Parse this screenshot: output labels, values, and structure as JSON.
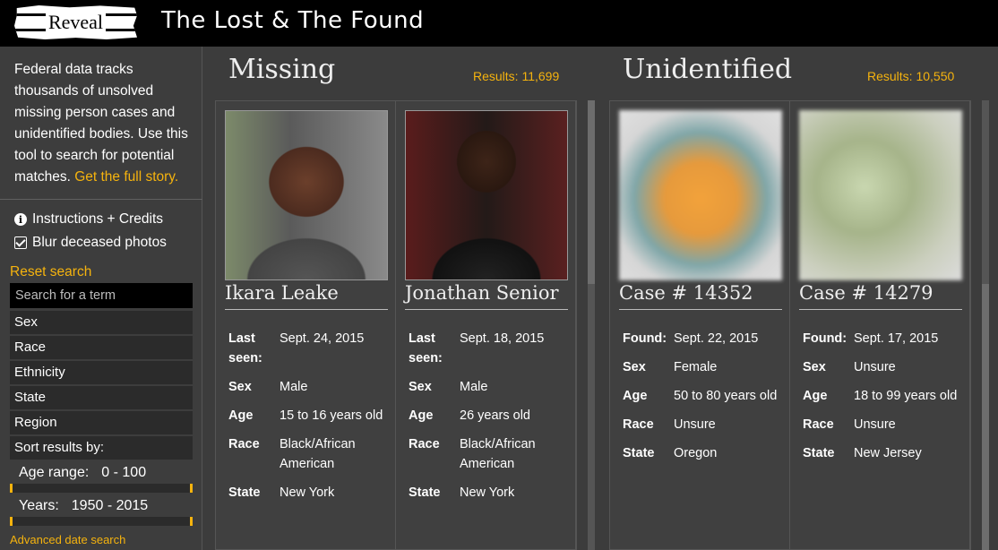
{
  "header": {
    "logo": "Reveal",
    "title": "The Lost & The Found"
  },
  "sidebar": {
    "intro": "Federal data tracks thousands of unsolved missing person cases and unidentified bodies. Use this tool to search for potential matches.",
    "intro_link": "Get the full story.",
    "instructions_label": "Instructions + Credits",
    "blur_label": "Blur deceased photos",
    "reset_label": "Reset search",
    "search_placeholder": "Search for a term",
    "filters": [
      "Sex",
      "Race",
      "Ethnicity",
      "State",
      "Region",
      "Sort results by:"
    ],
    "age_label": "Age range:",
    "age_value": "0 - 100",
    "years_label": "Years:",
    "years_value": "1950 - 2015",
    "advanced_label": "Advanced date search"
  },
  "missing": {
    "title": "Missing",
    "results": "Results: 11,699",
    "cards": [
      {
        "name": "Ikara Leake",
        "rows": [
          {
            "k": "Last seen:",
            "v": "Sept. 24, 2015"
          },
          {
            "k": "Sex",
            "v": "Male"
          },
          {
            "k": "Age",
            "v": "15 to 16 years old"
          },
          {
            "k": "Race",
            "v": "Black/African American"
          },
          {
            "k": "State",
            "v": "New York"
          }
        ]
      },
      {
        "name": "Jonathan Senior",
        "rows": [
          {
            "k": "Last seen:",
            "v": "Sept. 18, 2015"
          },
          {
            "k": "Sex",
            "v": "Male"
          },
          {
            "k": "Age",
            "v": "26 years old"
          },
          {
            "k": "Race",
            "v": "Black/African American"
          },
          {
            "k": "State",
            "v": "New York"
          }
        ]
      }
    ]
  },
  "unidentified": {
    "title": "Unidentified",
    "results": "Results: 10,550",
    "cards": [
      {
        "name": "Case # 14352",
        "rows": [
          {
            "k": "Found:",
            "v": "Sept. 22, 2015"
          },
          {
            "k": "Sex",
            "v": "Female"
          },
          {
            "k": "Age",
            "v": "50 to 80 years old"
          },
          {
            "k": "Race",
            "v": "Unsure"
          },
          {
            "k": "State",
            "v": "Oregon"
          }
        ]
      },
      {
        "name": "Case # 14279",
        "rows": [
          {
            "k": "Found:",
            "v": "Sept. 17, 2015"
          },
          {
            "k": "Sex",
            "v": "Unsure"
          },
          {
            "k": "Age",
            "v": "18 to 99 years old"
          },
          {
            "k": "Race",
            "v": "Unsure"
          },
          {
            "k": "State",
            "v": "New Jersey"
          }
        ]
      }
    ]
  }
}
